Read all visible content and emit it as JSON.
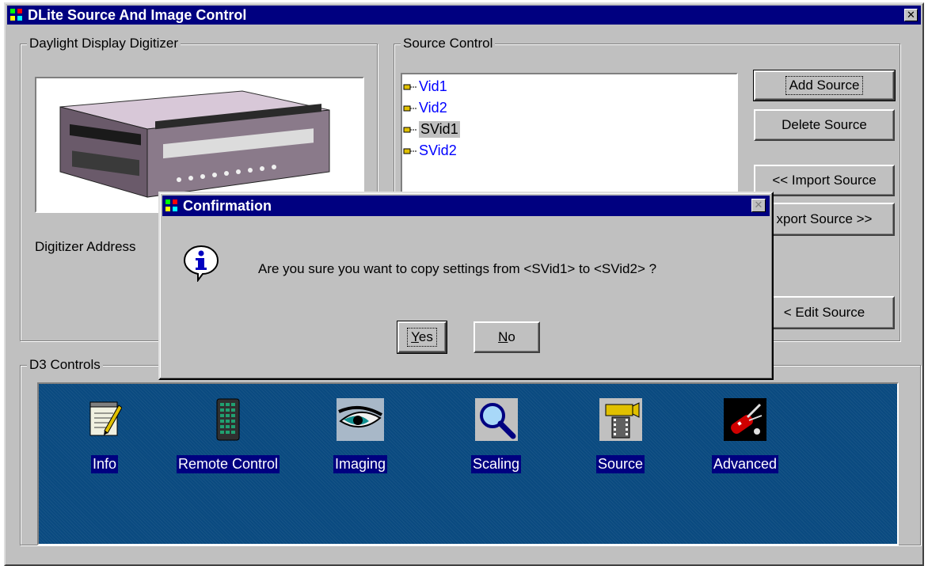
{
  "window": {
    "title": "DLite Source And Image Control",
    "close_glyph": "✕"
  },
  "digitizer": {
    "group_label": "Daylight Display Digitizer",
    "address_label": "Digitizer Address"
  },
  "source_control": {
    "group_label": "Source Control",
    "items": [
      {
        "label": "Vid1",
        "selected": false
      },
      {
        "label": "Vid2",
        "selected": false
      },
      {
        "label": "SVid1",
        "selected": true
      },
      {
        "label": "SVid2",
        "selected": false
      }
    ],
    "buttons": {
      "add": "Add Source",
      "delete": "Delete Source",
      "import": "<< Import Source",
      "export": "xport Source >>",
      "edit": "< Edit  Source"
    }
  },
  "d3_controls": {
    "group_label": "D3 Controls",
    "tools": [
      {
        "label": "Info",
        "icon": "notepad-pencil-icon"
      },
      {
        "label": "Remote Control",
        "icon": "remote-control-icon"
      },
      {
        "label": "Imaging",
        "icon": "eye-icon"
      },
      {
        "label": "Scaling",
        "icon": "magnifier-icon"
      },
      {
        "label": "Source",
        "icon": "video-camera-icon"
      },
      {
        "label": "Advanced",
        "icon": "swiss-knife-icon"
      }
    ]
  },
  "dialog": {
    "title": "Confirmation",
    "message": "Are you sure you want to copy settings from <SVid1> to <SVid2> ?",
    "yes": "Yes",
    "no": "No",
    "close_glyph": "✕"
  },
  "colors": {
    "title_bar": "#000080",
    "face": "#c0c0c0",
    "d3_panel": "#0a4a80",
    "list_text": "#0000ff"
  }
}
